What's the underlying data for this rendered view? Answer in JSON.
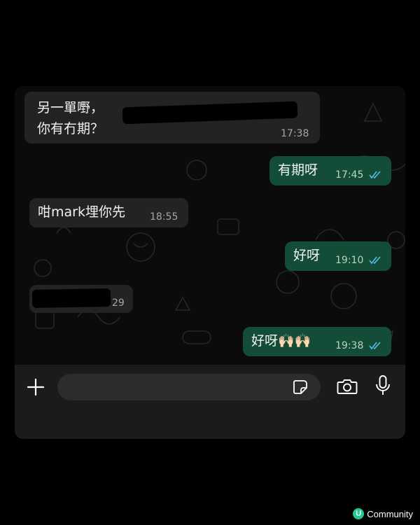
{
  "messages": [
    {
      "direction": "incoming",
      "text": "另一單嘢，\n你有冇期？",
      "time": "17:38",
      "redacted": true
    },
    {
      "direction": "outgoing",
      "text": "有期呀",
      "time": "17:45",
      "status": "read"
    },
    {
      "direction": "incoming",
      "text": "咁mark埋你先",
      "time": "18:55"
    },
    {
      "direction": "outgoing",
      "text": "好呀",
      "time": "19:10",
      "status": "read"
    },
    {
      "direction": "incoming",
      "text": "",
      "time": "29",
      "redacted": true
    },
    {
      "direction": "outgoing",
      "text": "好呀🙌🏻🙌🏻",
      "time": "19:38",
      "status": "read"
    }
  ],
  "composer": {
    "add_icon": "plus-icon",
    "input_placeholder": "",
    "sticker_icon": "sticker-icon",
    "camera_icon": "camera-icon",
    "mic_icon": "microphone-icon"
  },
  "watermark": {
    "text": "Community",
    "logo_letter": "U"
  },
  "colors": {
    "background": "#000000",
    "chat_background": "#0b0b0b",
    "incoming_bubble": "#232323",
    "outgoing_bubble": "#144d37",
    "read_ticks": "#53bdeb",
    "watermark_logo": "#24c98a"
  }
}
